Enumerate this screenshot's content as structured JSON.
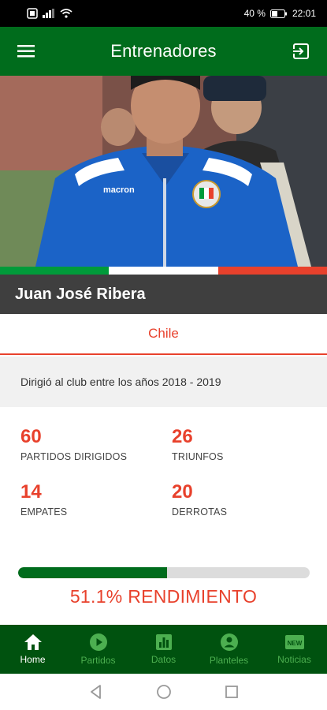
{
  "status_bar": {
    "battery_text": "40 %",
    "time": "22:01"
  },
  "app_bar": {
    "title": "Entrenadores",
    "menu_icon": "hamburger-menu-icon",
    "action_icon": "logout-icon"
  },
  "coach": {
    "name": "Juan José Ribera",
    "country": "Chile",
    "period": "Dirigió al club entre los años 2018 - 2019"
  },
  "stats": {
    "matches_value": "60",
    "matches_label": "PARTIDOS DIRIGIDOS",
    "wins_value": "26",
    "wins_label": "TRIUNFOS",
    "draws_value": "14",
    "draws_label": "EMPATES",
    "losses_value": "20",
    "losses_label": "DERROTAS"
  },
  "performance": {
    "percent": 51.1,
    "text": "51.1% RENDIMIENTO"
  },
  "bottom_nav": {
    "items": [
      {
        "label": "Home",
        "icon": "home-icon",
        "active": true
      },
      {
        "label": "Partidos",
        "icon": "play-circle-icon",
        "active": false
      },
      {
        "label": "Datos",
        "icon": "bar-chart-icon",
        "active": false
      },
      {
        "label": "Planteles",
        "icon": "person-icon",
        "active": false
      },
      {
        "label": "Noticias",
        "icon": "new-badge-icon",
        "active": false
      }
    ]
  },
  "colors": {
    "primary_green": "#006c1c",
    "nav_green": "#00520f",
    "accent_red": "#e8412c",
    "flag_green": "#009b3a",
    "flag_white": "#ffffff",
    "flag_red": "#e8412c"
  }
}
